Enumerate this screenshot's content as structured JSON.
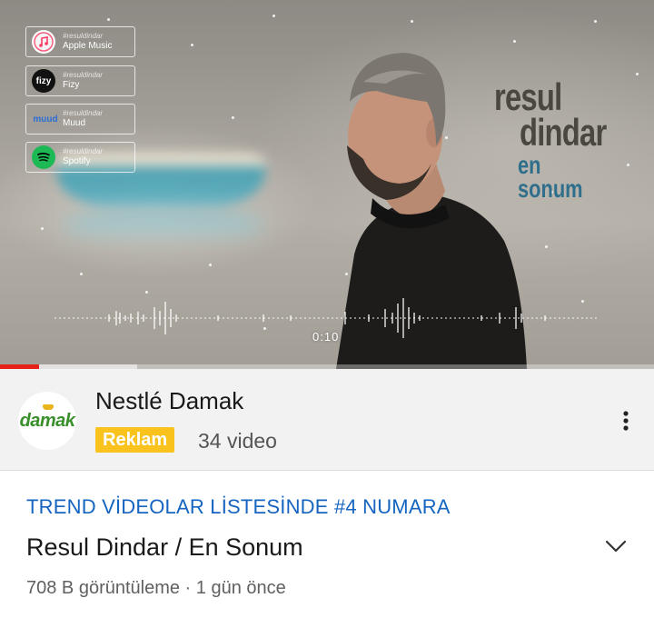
{
  "player": {
    "streaming_links": [
      {
        "tag": "#resuldindar",
        "name": "Apple Music",
        "icon": "apple-music-icon"
      },
      {
        "tag": "#resuldindar",
        "name": "Fizy",
        "icon": "fizy-icon",
        "icon_text": "fizy"
      },
      {
        "tag": "#resuldindar",
        "name": "Muud",
        "icon": "muud-icon",
        "icon_text": "muud"
      },
      {
        "tag": "#resuldindar",
        "name": "Spotify",
        "icon": "spotify-icon"
      }
    ],
    "title_art": {
      "line1": "resul",
      "line2": "dindar",
      "line3": "en sonum"
    },
    "current_time": "0:10",
    "progress_fraction": 0.06,
    "buffer_fraction": 0.21
  },
  "channel": {
    "avatar_text": "damak",
    "name": "Nestlé Damak",
    "badge": "Reklam",
    "video_count": "34 video"
  },
  "video": {
    "trend_label": "TREND VİDEOLAR LİSTESİNDE #4 NUMARA",
    "title": "Resul Dindar / En Sonum",
    "meta": "708 B görüntüleme · 1 gün önce"
  },
  "colors": {
    "accent_red": "#e62117",
    "link_blue": "#1565c0",
    "ad_yellow": "#f9c21c",
    "spotify_green": "#1db954"
  }
}
